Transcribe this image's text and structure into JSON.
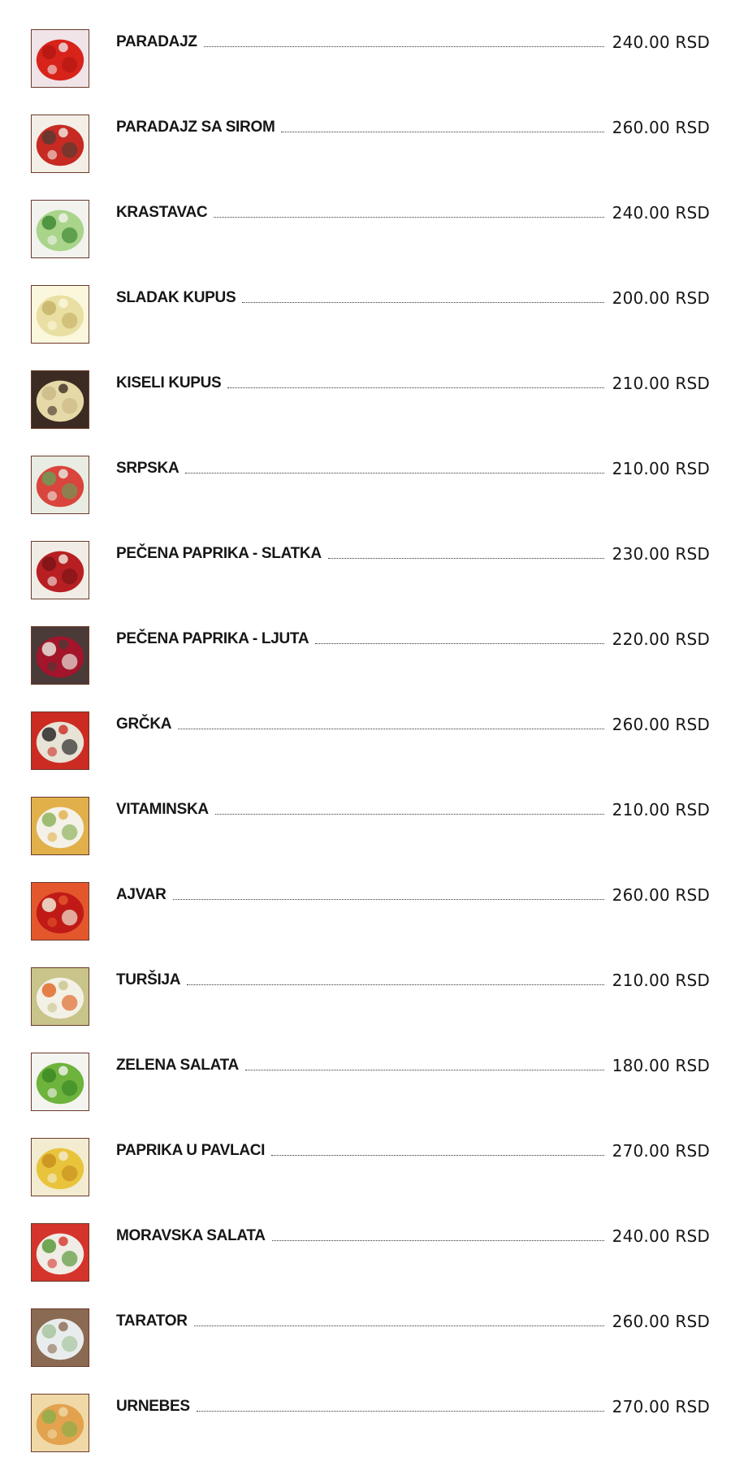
{
  "menu": {
    "items": [
      {
        "name": "PARADAJZ",
        "price": "240.00 RSD",
        "image": "tomato-salad-photo",
        "colors": [
          "#d8231b",
          "#f0e4e8",
          "#b51812"
        ]
      },
      {
        "name": "PARADAJZ SA SIROM",
        "price": "260.00 RSD",
        "image": "tomato-cheese-salad-photo",
        "colors": [
          "#c62a22",
          "#f3efe6",
          "#5a3a30"
        ]
      },
      {
        "name": "KRASTAVAC",
        "price": "240.00 RSD",
        "image": "cucumber-salad-photo",
        "colors": [
          "#a9d48a",
          "#f2f2ee",
          "#3f8a35"
        ]
      },
      {
        "name": "SLADAK KUPUS",
        "price": "200.00 RSD",
        "image": "cabbage-salad-photo",
        "colors": [
          "#e9dfa2",
          "#fbf7dc",
          "#c8b46a"
        ]
      },
      {
        "name": "KISELI KUPUS",
        "price": "210.00 RSD",
        "image": "sauerkraut-photo",
        "colors": [
          "#e6d9a8",
          "#3b2b22",
          "#cdb888"
        ]
      },
      {
        "name": "SRPSKA",
        "price": "210.00 RSD",
        "image": "serbian-salad-photo",
        "colors": [
          "#d9453c",
          "#e9ece2",
          "#6d9a55"
        ]
      },
      {
        "name": "PEČENA PAPRIKA - SLATKA",
        "price": "230.00 RSD",
        "image": "roasted-sweet-pepper-photo",
        "colors": [
          "#b81f22",
          "#f1ede6",
          "#7a1416"
        ]
      },
      {
        "name": "PEČENA PAPRIKA - LJUTA",
        "price": "220.00 RSD",
        "image": "roasted-hot-pepper-photo",
        "colors": [
          "#a3152a",
          "#4a3a38",
          "#e7e2dc"
        ]
      },
      {
        "name": "GRČKA",
        "price": "260.00 RSD",
        "image": "greek-salad-photo",
        "colors": [
          "#e7e3d6",
          "#cc2b22",
          "#2a2a2a"
        ]
      },
      {
        "name": "VITAMINSKA",
        "price": "210.00 RSD",
        "image": "vitamin-salad-photo",
        "colors": [
          "#f4f1e8",
          "#e1b04a",
          "#8fb45c"
        ]
      },
      {
        "name": "AJVAR",
        "price": "260.00 RSD",
        "image": "ajvar-photo",
        "colors": [
          "#c01a17",
          "#e4572d",
          "#f1e9d5"
        ]
      },
      {
        "name": "TURŠIJA",
        "price": "210.00 RSD",
        "image": "pickled-vegetables-photo",
        "colors": [
          "#f3f0e6",
          "#c8c48a",
          "#e06b2b"
        ]
      },
      {
        "name": "ZELENA SALATA",
        "price": "180.00 RSD",
        "image": "green-salad-photo",
        "colors": [
          "#6db33c",
          "#f4f4f0",
          "#3d8a25"
        ]
      },
      {
        "name": "PAPRIKA U PAVLACI",
        "price": "270.00 RSD",
        "image": "pepper-in-cream-photo",
        "colors": [
          "#e8c43c",
          "#f3ecd0",
          "#c9921d"
        ]
      },
      {
        "name": "MORAVSKA SALATA",
        "price": "240.00 RSD",
        "image": "moravian-salad-photo",
        "colors": [
          "#f0ece6",
          "#d4342b",
          "#5a9a3a"
        ]
      },
      {
        "name": "TARATOR",
        "price": "260.00 RSD",
        "image": "tarator-photo",
        "colors": [
          "#e9ecec",
          "#8a6a52",
          "#a7c6a0"
        ]
      },
      {
        "name": "URNEBES",
        "price": "270.00 RSD",
        "image": "urnebes-photo",
        "colors": [
          "#e2a24e",
          "#f0d9a6",
          "#8fae4a"
        ]
      }
    ]
  }
}
